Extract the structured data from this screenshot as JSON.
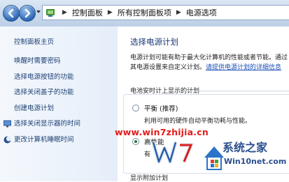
{
  "address_bar": {
    "crumbs": [
      "控制面板",
      "所有控制面板项",
      "电源选项"
    ]
  },
  "left_pane": {
    "home_link": "控制面板主页",
    "links": [
      {
        "label": "唤醒时需要密码",
        "icon": ""
      },
      {
        "label": "选择电源按钮的功能",
        "icon": ""
      },
      {
        "label": "选择关闭盖子的功能",
        "icon": ""
      },
      {
        "label": "创建电源计划",
        "icon": ""
      },
      {
        "label": "选择关闭显示器的时间",
        "icon": "monitor-icon"
      },
      {
        "label": "更改计算机睡眠时间",
        "icon": "moon-icon"
      }
    ]
  },
  "main": {
    "title": "选择电源计划",
    "description_line1": "电源计划可能有助于最大化计算机的性能或者节能。通过",
    "description_line2_prefix": "其电源设置来自定义计划。",
    "description_link": "请提供电源计划的详细信息",
    "section_label": "电池安时计上显示的计划",
    "plans": [
      {
        "name": "平衡 (推荐)",
        "description": "利用可用的硬件自动平衡功耗与性能。",
        "selected": false
      },
      {
        "name": "高性能",
        "description": "有",
        "selected": true
      }
    ],
    "show_more": "显示附加计划"
  },
  "watermark": {
    "url": "www.win7zhijia.cn",
    "badge_name": "系统之家",
    "badge_url": "Win10net.com"
  }
}
